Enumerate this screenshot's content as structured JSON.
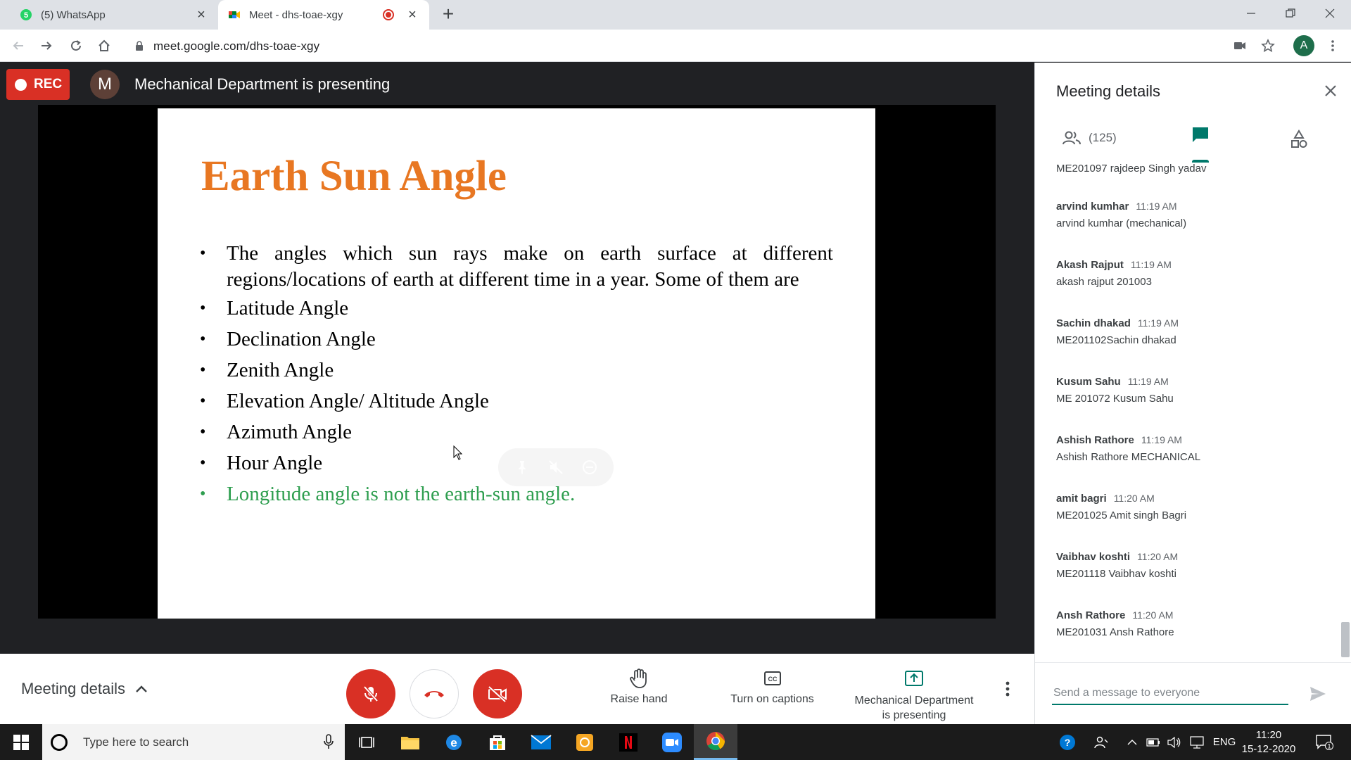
{
  "browser": {
    "tabs": [
      {
        "label": "(5) WhatsApp",
        "badge": "5",
        "active": false
      },
      {
        "label": "Meet - dhs-toae-xgy",
        "active": true
      }
    ],
    "url": "meet.google.com/dhs-toae-xgy",
    "profile_initial": "A"
  },
  "meet": {
    "rec_label": "REC",
    "presenter_initial": "M",
    "presenting_title": "Mechanical Department is presenting"
  },
  "slide": {
    "title": "Earth Sun Angle",
    "bullets": [
      "The angles which sun rays make on earth surface at different regions/locations of earth at different time in a year. Some of them are",
      "Latitude Angle",
      "Declination Angle",
      "Zenith Angle",
      "Elevation Angle/ Altitude Angle",
      "Azimuth Angle",
      "Hour Angle",
      "Longitude angle is not the earth-sun angle."
    ],
    "title_color": "#e87722",
    "note_color": "#2e9e4f"
  },
  "controls": {
    "meeting_details": "Meeting details",
    "raise_hand": "Raise hand",
    "captions": "Turn on captions",
    "present_line1": "Mechanical Department",
    "present_line2": "is presenting",
    "mic_state": "muted",
    "camera_state": "off"
  },
  "panel": {
    "title": "Meeting details",
    "people_count": "(125)",
    "active_tab": "chat",
    "accent_color": "#00796b",
    "messages": [
      {
        "sender": "",
        "time": "",
        "text": "ME201097 rajdeep Singh yadav"
      },
      {
        "sender": "arvind kumhar",
        "time": "11:19 AM",
        "text": "arvind kumhar (mechanical)"
      },
      {
        "sender": "Akash Rajput",
        "time": "11:19 AM",
        "text": "akash rajput 201003"
      },
      {
        "sender": "Sachin dhakad",
        "time": "11:19 AM",
        "text": "ME201102Sachin dhakad"
      },
      {
        "sender": "Kusum Sahu",
        "time": "11:19 AM",
        "text": "ME 201072 Kusum Sahu"
      },
      {
        "sender": "Ashish Rathore",
        "time": "11:19 AM",
        "text": "Ashish Rathore MECHANICAL"
      },
      {
        "sender": "amit bagri",
        "time": "11:20 AM",
        "text": "ME201025 Amit singh Bagri"
      },
      {
        "sender": "Vaibhav koshti",
        "time": "11:20 AM",
        "text": "ME201118 Vaibhav koshti"
      },
      {
        "sender": "Ansh Rathore",
        "time": "11:20 AM",
        "text": "ME201031 Ansh Rathore"
      }
    ],
    "input_placeholder": "Send a message to everyone"
  },
  "taskbar": {
    "search_placeholder": "Type here to search",
    "language": "ENG",
    "time": "11:20",
    "date": "15-12-2020",
    "notification_count": "1"
  }
}
